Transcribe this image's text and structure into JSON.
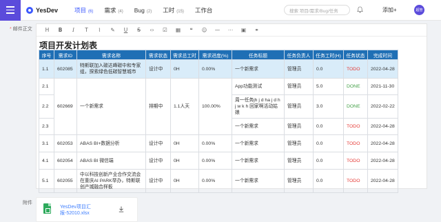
{
  "app": {
    "logo": "YesDev"
  },
  "nav": {
    "items": [
      {
        "label": "项目",
        "count": "(6)",
        "active": true
      },
      {
        "label": "需求",
        "count": "(4)",
        "active": false
      },
      {
        "label": "Bug",
        "count": "(2)",
        "active": false
      },
      {
        "label": "工时",
        "count": "(15)",
        "active": false
      },
      {
        "label": "工作台",
        "count": "",
        "active": false
      }
    ]
  },
  "search": {
    "placeholder": "搜索 项目/需求/Bug/任务"
  },
  "header": {
    "add_label": "添加+",
    "avatar_text": "超管"
  },
  "field": {
    "required_mark": "*",
    "label": "邮件正文"
  },
  "toolbar": {
    "icons": [
      "heading-icon",
      "bold-icon",
      "italic-icon",
      "text-size-icon",
      "highlight-icon",
      "pen-icon",
      "underline-icon",
      "strikethrough-icon",
      "code-icon",
      "checkbox-icon",
      "table-icon",
      "quote-icon",
      "emoji-icon",
      "divider-icon",
      "more-icon",
      "image-icon",
      "link-icon"
    ],
    "glyphs": [
      "H",
      "B",
      "I",
      "T",
      "⌇",
      "✎",
      "U",
      "S",
      "‹›",
      "☑",
      "▦",
      "❝",
      "☺",
      "—",
      "⋯",
      "▣",
      "⚭"
    ]
  },
  "document": {
    "title": "项目开发计划表"
  },
  "table": {
    "headers": [
      "序号",
      "需求ID",
      "需求名称",
      "需求状态",
      "需求总工时",
      "需求进度(%)",
      "任务标题",
      "任务负责人",
      "任务工时(H)",
      "任务状态",
      "完成时间"
    ],
    "rows": [
      {
        "no": "1.1",
        "req_id": "602085",
        "req_name": "特斯联加入碳达峰碳中和专家组，探索绿色低碳智慧城市",
        "req_status": "设计中",
        "req_hours": "0H",
        "req_progress": "0.00%",
        "task_title": "一个新需求",
        "task_owner": "管理员",
        "task_hours": "0.0",
        "task_status": "TODO",
        "done_time": "2022-04-28"
      },
      {
        "no": "2.1",
        "req_id": "602669",
        "req_name": "一个新需求",
        "req_status": "排期中",
        "req_hours": "1.1人天",
        "req_progress": "100.00%",
        "task_title": "App功能测试",
        "task_owner": "管理员",
        "task_hours": "5.0",
        "task_status": "DONE",
        "done_time": "2021-11-30"
      },
      {
        "no": "2.2",
        "task_title": "周一任务jh j d ha j d h j w k h 回家啊活动姑娘",
        "task_owner": "管理员",
        "task_hours": "3.0",
        "task_status": "DONE",
        "done_time": "2022-02-22"
      },
      {
        "no": "2.3",
        "task_title": "一个新需求",
        "task_owner": "管理员",
        "task_hours": "0.0",
        "task_status": "TODO",
        "done_time": "2022-04-28"
      },
      {
        "no": "3.1",
        "req_id": "602053",
        "req_name": "ABAS BI+数据分析",
        "req_status": "设计中",
        "req_hours": "0H",
        "req_progress": "0.00%",
        "task_title": "一个新需求",
        "task_owner": "管理员",
        "task_hours": "0.0",
        "task_status": "TODO",
        "done_time": "2022-04-28"
      },
      {
        "no": "4.1",
        "req_id": "602054",
        "req_name": "ABAS BI 微信端",
        "req_status": "设计中",
        "req_hours": "0H",
        "req_progress": "0.00%",
        "task_title": "一个新需求",
        "task_owner": "管理员",
        "task_hours": "0.0",
        "task_status": "TODO",
        "done_time": "2022-04-28"
      },
      {
        "no": "5.1",
        "req_id": "602055",
        "req_name": "中以科技创新产业合作交流会在重庆AI PARK举办，特斯联创产城融合样板",
        "req_status": "设计中",
        "req_hours": "0H",
        "req_progress": "0.00%",
        "task_title": "一个新需求",
        "task_owner": "管理员",
        "task_hours": "0.0",
        "task_status": "TODO",
        "done_time": "2022-04-28"
      }
    ]
  },
  "attachment": {
    "label": "附件",
    "file_name": "YesDev项目汇报-52010.xlsx"
  },
  "colors": {
    "brand": "#5b4bdb",
    "link": "#3d7dfe",
    "header_bg": "#1f6fb5",
    "todo": "#e53935",
    "done": "#43a047",
    "selected_row": "#d9ecf9"
  }
}
